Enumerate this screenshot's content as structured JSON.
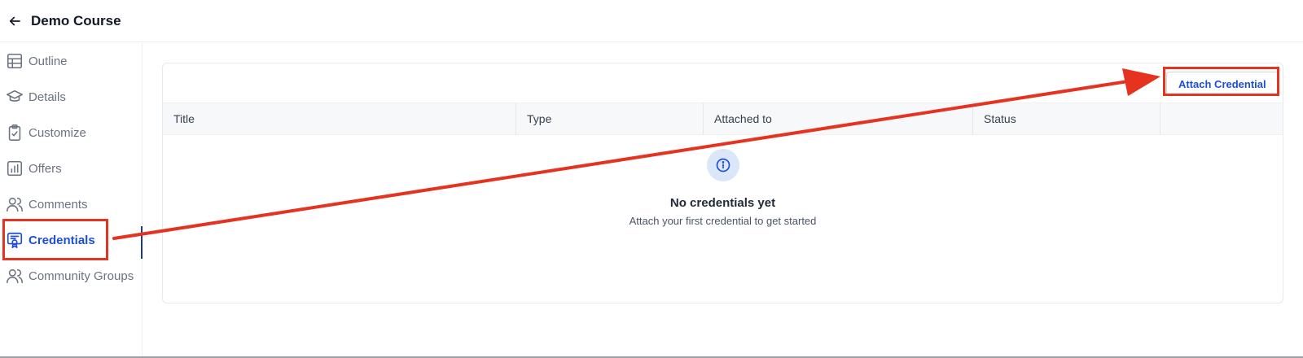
{
  "header": {
    "title": "Demo Course",
    "back_icon": "arrow-left-icon"
  },
  "sidebar": {
    "items": [
      {
        "label": "Outline",
        "icon": "table-grid-icon",
        "active": false
      },
      {
        "label": "Details",
        "icon": "graduation-cap-icon",
        "active": false
      },
      {
        "label": "Customize",
        "icon": "clipboard-check-icon",
        "active": false
      },
      {
        "label": "Offers",
        "icon": "bar-chart-icon",
        "active": false
      },
      {
        "label": "Comments",
        "icon": "users-icon",
        "active": false
      },
      {
        "label": "Credentials",
        "icon": "certificate-icon",
        "active": true
      },
      {
        "label": "Community Groups",
        "icon": "users-icon",
        "active": false
      }
    ]
  },
  "main": {
    "attach_button": "Attach Credential",
    "columns": [
      "Title",
      "Type",
      "Attached to",
      "Status",
      ""
    ],
    "empty_state": {
      "icon": "info-icon",
      "title": "No credentials yet",
      "subtitle": "Attach your first credential to get started"
    }
  },
  "colors": {
    "accent": "#1d4ed8",
    "annotation": "#e5331f",
    "empty_icon_bg": "#dbe6f8"
  }
}
